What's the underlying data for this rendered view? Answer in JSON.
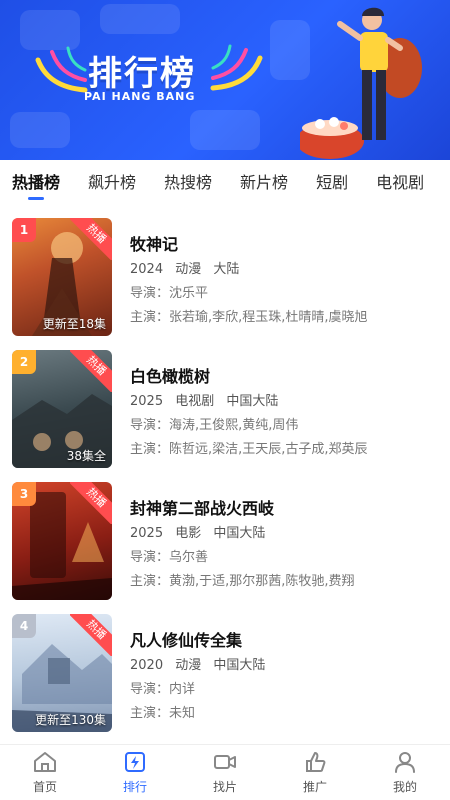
{
  "banner": {
    "title": "排行榜",
    "subtitle": "PAI HANG BANG"
  },
  "tabs": [
    {
      "label": "热播榜",
      "active": true
    },
    {
      "label": "飙升榜",
      "active": false
    },
    {
      "label": "热搜榜",
      "active": false
    },
    {
      "label": "新片榜",
      "active": false
    },
    {
      "label": "短剧",
      "active": false
    },
    {
      "label": "电视剧",
      "active": false
    }
  ],
  "items": [
    {
      "rank": "1",
      "badge": "热播",
      "episode": "更新至18集",
      "title": "牧神记",
      "year": "2024",
      "type": "动漫",
      "region": "大陆",
      "director": "导演：沈乐平",
      "cast": "主演：张若瑜,李欣,程玉珠,杜晴晴,虞晓旭",
      "rank_color": "#ff4d4f"
    },
    {
      "rank": "2",
      "badge": "热播",
      "episode": "38集全",
      "title": "白色橄榄树",
      "year": "2025",
      "type": "电视剧",
      "region": "中国大陆",
      "director": "导演：海涛,王俊熙,黄纯,周伟",
      "cast": "主演：陈哲远,梁洁,王天辰,古子成,郑英辰",
      "rank_color": "#ffb02e"
    },
    {
      "rank": "3",
      "badge": "热播",
      "episode": "",
      "title": "封神第二部战火西岐",
      "year": "2025",
      "type": "电影",
      "region": "中国大陆",
      "director": "导演：乌尔善",
      "cast": "主演：黄渤,于适,那尔那茜,陈牧驰,费翔",
      "rank_color": "#ff8a3d"
    },
    {
      "rank": "4",
      "badge": "热播",
      "episode": "更新至130集",
      "title": "凡人修仙传全集",
      "year": "2020",
      "type": "动漫",
      "region": "中国大陆",
      "director": "导演：内详",
      "cast": "主演：未知",
      "rank_color": "#b8bfcc"
    }
  ],
  "nav": [
    {
      "label": "首页",
      "icon": "home-icon",
      "active": false
    },
    {
      "label": "排行",
      "icon": "ranking-icon",
      "active": true
    },
    {
      "label": "找片",
      "icon": "video-camera-icon",
      "active": false
    },
    {
      "label": "推广",
      "icon": "thumbs-up-icon",
      "active": false
    },
    {
      "label": "我的",
      "icon": "user-icon",
      "active": false
    }
  ],
  "colors": {
    "accent": "#2f6bff",
    "banner": "#2a62ff",
    "hot_badge": "#ff4d4f"
  }
}
